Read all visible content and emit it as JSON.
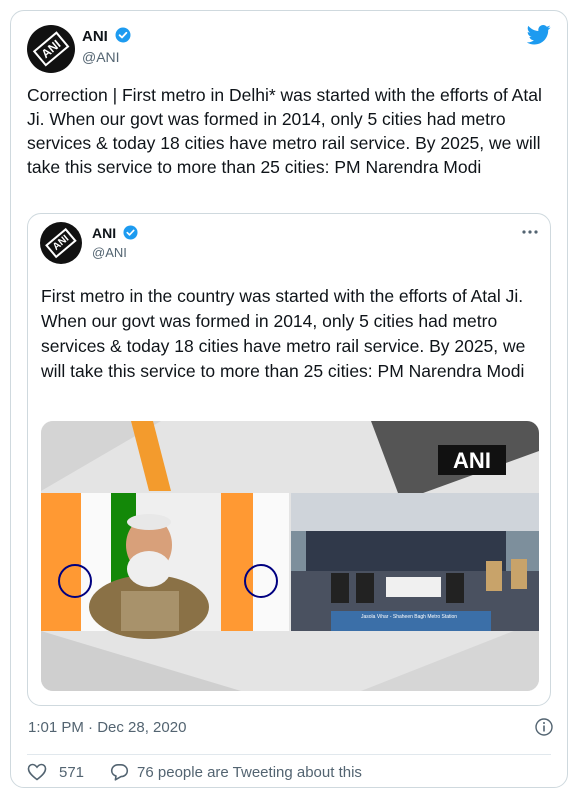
{
  "tweet": {
    "author_name": "ANI",
    "author_handle": "@ANI",
    "avatar_logo": "ANI",
    "text": "Correction | First metro in Delhi* was started with the efforts of Atal Ji. When our govt was formed in 2014, only 5 cities had metro services & today 18 cities have metro rail service. By 2025, we will take this service to more than 25 cities: PM Narendra Modi",
    "timestamp": "1:01 PM · Dec 28, 2020",
    "like_count": "571",
    "reply_text": "76 people are Tweeting about this"
  },
  "quoted": {
    "author_name": "ANI",
    "author_handle": "@ANI",
    "text": "First metro in the country was started with the efforts of Atal Ji. When our govt was formed in 2014, only 5 cities had metro services & today 18 cities have metro rail service. By 2025, we will take this service to more than 25 cities: PM Narendra Modi",
    "media_watermark": "ANI",
    "media_caption": "Jasola Vihar - Shaheen Bagh Metro Station"
  },
  "icons": {
    "twitter": "twitter-bird-icon",
    "verified": "verified-badge-icon",
    "more": "more-options-icon",
    "info": "info-icon",
    "heart": "heart-icon",
    "reply": "reply-bubble-icon"
  },
  "colors": {
    "twitter_blue": "#1d9bf0",
    "text": "#0f1419",
    "muted": "#536471",
    "border": "#cfd9de"
  }
}
